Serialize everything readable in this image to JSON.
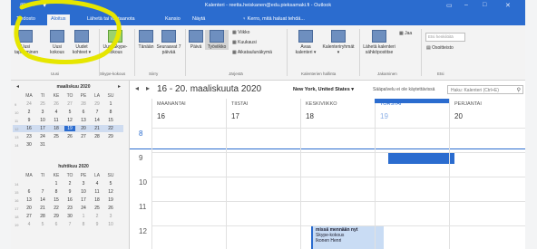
{
  "window": {
    "title": "Kalenteri - reetta.heiskanen@edu.pieksamaki.fi - Outlook"
  },
  "tabs": [
    "Tiedosto",
    "Aloitus",
    "Lähetä tai vastaanota",
    "Kansio",
    "Näytä"
  ],
  "tell_me": "♀ Kerro, mitä haluat tehdä...",
  "ribbon": {
    "new_appointment": "Uusi tapaaminen",
    "new_meeting": "Uusi kokous",
    "new_items": "Uudet kohteet ▾",
    "new_skype": "Uusi Skype-kokous",
    "today": "Tänään",
    "next7": "Seuraavat 7 päivää",
    "day": "Päivä",
    "workweek": "Työviikko",
    "week": "Viikko",
    "month": "Kuukausi",
    "schedule": "Aikataulunäkymä",
    "open_calendar": "Avaa kalenteri ▾",
    "calendar_groups": "Kalenteriryhmät ▾",
    "email_calendar": "Lähetä kalenteri sähköpostitse",
    "share": "Jaa",
    "find_people": "Etsi henkilöitä",
    "address_book": "Osoitteisto",
    "groups": [
      "Uusi",
      "Skype-kokous",
      "Siirry",
      "Järjestä",
      "Kalenterien hallinta",
      "Jakaminen",
      "Etsi"
    ]
  },
  "mini_cal_1": {
    "header": "maaliskuu 2020",
    "dow": [
      "MA",
      "TI",
      "KE",
      "TO",
      "PE",
      "LA",
      "SU"
    ],
    "weeks": [
      "9",
      "10",
      "11",
      "12",
      "13",
      "14"
    ],
    "rows": [
      [
        "24",
        "25",
        "26",
        "27",
        "28",
        "29",
        "1"
      ],
      [
        "2",
        "3",
        "4",
        "5",
        "6",
        "7",
        "8"
      ],
      [
        "9",
        "10",
        "11",
        "12",
        "13",
        "14",
        "15"
      ],
      [
        "16",
        "17",
        "18",
        "19",
        "20",
        "21",
        "22"
      ],
      [
        "23",
        "24",
        "25",
        "26",
        "27",
        "28",
        "29"
      ],
      [
        "30",
        "31",
        "",
        "",
        "",
        "",
        ""
      ]
    ]
  },
  "mini_cal_2": {
    "header": "huhtikuu 2020",
    "dow": [
      "MA",
      "TI",
      "KE",
      "TO",
      "PE",
      "LA",
      "SU"
    ],
    "weeks": [
      "14",
      "15",
      "16",
      "17",
      "18",
      "19"
    ],
    "rows": [
      [
        "",
        "",
        "1",
        "2",
        "3",
        "4",
        "5"
      ],
      [
        "6",
        "7",
        "8",
        "9",
        "10",
        "11",
        "12"
      ],
      [
        "13",
        "14",
        "15",
        "16",
        "17",
        "18",
        "19"
      ],
      [
        "20",
        "21",
        "22",
        "23",
        "24",
        "25",
        "26"
      ],
      [
        "27",
        "28",
        "29",
        "30",
        "1",
        "2",
        "3"
      ],
      [
        "4",
        "5",
        "6",
        "7",
        "8",
        "9",
        "10"
      ]
    ]
  },
  "toolbar": {
    "date_range": "16 - 20. maaliskuuta 2020",
    "location": "New York, United States ▾",
    "weather": "Sääpalvelu ei ole käytettävissä",
    "search_placeholder": "Haku: Kalenteri (Ctrl+E)"
  },
  "days": [
    {
      "name": "MAANANTAI",
      "date": "16"
    },
    {
      "name": "TIISTAI",
      "date": "17"
    },
    {
      "name": "KESKIVIIKKO",
      "date": "18"
    },
    {
      "name": "TORSTAI",
      "date": "19"
    },
    {
      "name": "PERJANTAI",
      "date": "20"
    }
  ],
  "hours": [
    "8",
    "9",
    "10",
    "11",
    "12"
  ],
  "appointment": {
    "title": "missä mennään nyt",
    "line2": "Skype-kokous",
    "line3": "Ikonen Henri"
  },
  "colors": {
    "accent": "#2b6ccf",
    "annotation": "#e6e600"
  }
}
